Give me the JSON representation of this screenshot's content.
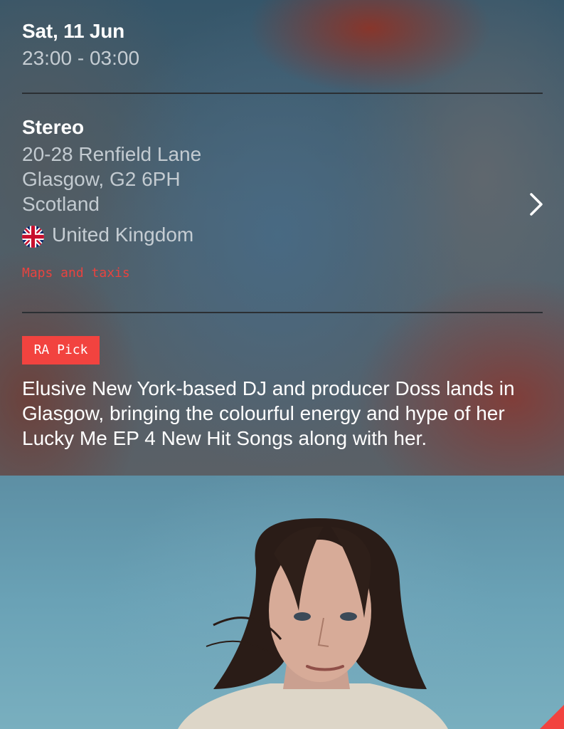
{
  "event": {
    "date": "Sat, 11 Jun",
    "time": "23:00 - 03:00"
  },
  "venue": {
    "name": "Stereo",
    "address_line1": "20-28 Renfield Lane",
    "address_line2": "Glasgow, G2 6PH",
    "address_line3": "Scotland",
    "country": "United Kingdom",
    "maps_link": "Maps and taxis"
  },
  "pick": {
    "badge": "RA Pick",
    "description": "Elusive New York-based DJ and producer Doss lands in Glasgow, bringing the colourful energy and hype of her Lucky Me EP 4 New Hit Songs along with her."
  },
  "icons": {
    "flag": "uk-flag-icon",
    "chevron": "chevron-right-icon"
  },
  "colors": {
    "accent": "#f2433f",
    "primary_text": "#ffffff",
    "secondary_text": "#c5cdd3",
    "divider": "#2b2f33"
  }
}
